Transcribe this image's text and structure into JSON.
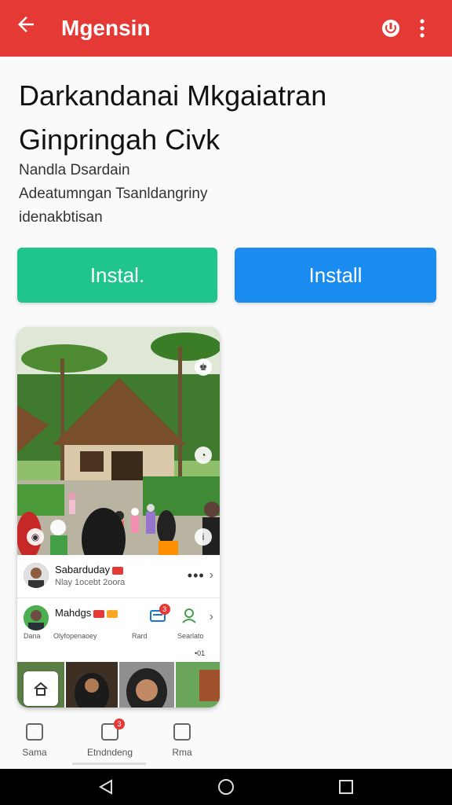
{
  "topbar": {
    "back_icon": "arrow-left-icon",
    "title": "Mgensin",
    "actions": [
      {
        "icon": "power-circle-icon"
      },
      {
        "icon": "more-vert-icon"
      }
    ],
    "color": "#e53935"
  },
  "page": {
    "title": "Darkandanai Mkgaiatran Ginpringah Civk",
    "subtitle_lines": [
      "Nandla Dsardain",
      "Adeatumngan Tsanldangriny",
      "idenakbtisan"
    ]
  },
  "buttons": [
    {
      "label": "Instal.",
      "color": "#1fc58d"
    },
    {
      "label": "Install",
      "color": "#1a8cf0"
    }
  ],
  "preview": {
    "row1": {
      "name": "Sabarduday",
      "sub": "Nlay 1ocebt 2oora"
    },
    "row2": {
      "name": "Mahdgs",
      "items": [
        {
          "label": "Dana"
        },
        {
          "label": "Olyfopenaoey"
        },
        {
          "label": "Rard",
          "badge": "3"
        },
        {
          "label": "Searlato"
        }
      ]
    },
    "status": "•01"
  },
  "bottom_nav": [
    {
      "label": "Sama",
      "icon": "inbox-icon"
    },
    {
      "label": "Etndndeng",
      "icon": "book-icon",
      "badge": "3"
    },
    {
      "label": "Rma",
      "icon": "square-target-icon"
    }
  ],
  "system_nav": [
    {
      "icon": "back-triangle-icon"
    },
    {
      "icon": "home-circle-icon"
    },
    {
      "icon": "recents-square-icon"
    }
  ]
}
